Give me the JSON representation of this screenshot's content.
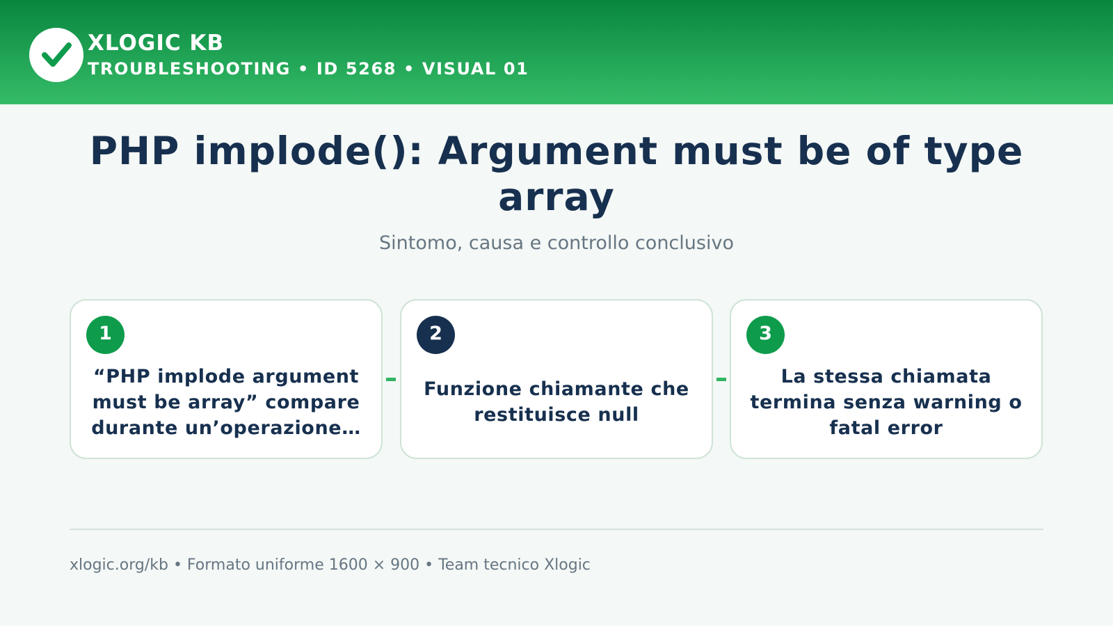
{
  "header": {
    "brand": "XLOGIC KB",
    "subtitle": "TROUBLESHOOTING • ID 5268 • VISUAL 01",
    "logo_icon": "check-badge-icon"
  },
  "title": "PHP implode(): Argument must be of type array",
  "subtitle": "Sintomo, causa e controllo conclusivo",
  "steps": [
    {
      "number": "1",
      "text": "“PHP implode argument must be array” compare durante un’operazione…",
      "badge_color": "#0e9c4c"
    },
    {
      "number": "2",
      "text": "Funzione chiamante che restituisce null",
      "badge_color": "#17304f"
    },
    {
      "number": "3",
      "text": "La stessa chiamata termina senza warning o fatal error",
      "badge_color": "#0e9c4c"
    }
  ],
  "footer": "xlogic.org/kb • Formato uniforme 1600 × 900 • Team tecnico Xlogic",
  "colors": {
    "accent_green": "#0e9c4c",
    "navy": "#17304f",
    "background": "#f4f8f6"
  }
}
